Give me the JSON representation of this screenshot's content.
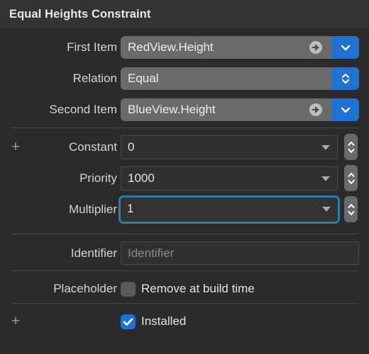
{
  "panel": {
    "title": "Equal Heights Constraint",
    "accent_blue": "#1d72d4",
    "focus_ring": "#2e7ca9",
    "background": "#2b2b2b",
    "titlebar_background": "#333333"
  },
  "rows": {
    "first_item": {
      "label": "First Item",
      "value": "RedView.Height",
      "reveal_icon": "circle-arrow-right-icon",
      "menu_icon": "chevron-down-icon"
    },
    "relation": {
      "label": "Relation",
      "value": "Equal",
      "menu_icon": "chevron-up-down-icon"
    },
    "second_item": {
      "label": "Second Item",
      "value": "BlueView.Height",
      "reveal_icon": "circle-arrow-right-icon",
      "menu_icon": "chevron-down-icon"
    },
    "constant": {
      "label": "Constant",
      "value": "0",
      "add_icon": "plus-icon",
      "dropdown_icon": "triangle-down-icon",
      "stepper_icon": "stepper-icon"
    },
    "priority": {
      "label": "Priority",
      "value": "1000",
      "dropdown_icon": "triangle-down-icon",
      "stepper_icon": "stepper-icon"
    },
    "multiplier": {
      "label": "Multiplier",
      "value": "1",
      "focused": true,
      "dropdown_icon": "triangle-down-icon",
      "stepper_icon": "stepper-icon"
    },
    "identifier": {
      "label": "Identifier",
      "value": "",
      "placeholder": "Identifier"
    },
    "placeholder": {
      "label": "Placeholder",
      "checkbox_label": "Remove at build time",
      "checked": false
    },
    "installed": {
      "label": "",
      "checkbox_label": "Installed",
      "checked": true,
      "add_icon": "plus-icon"
    }
  }
}
